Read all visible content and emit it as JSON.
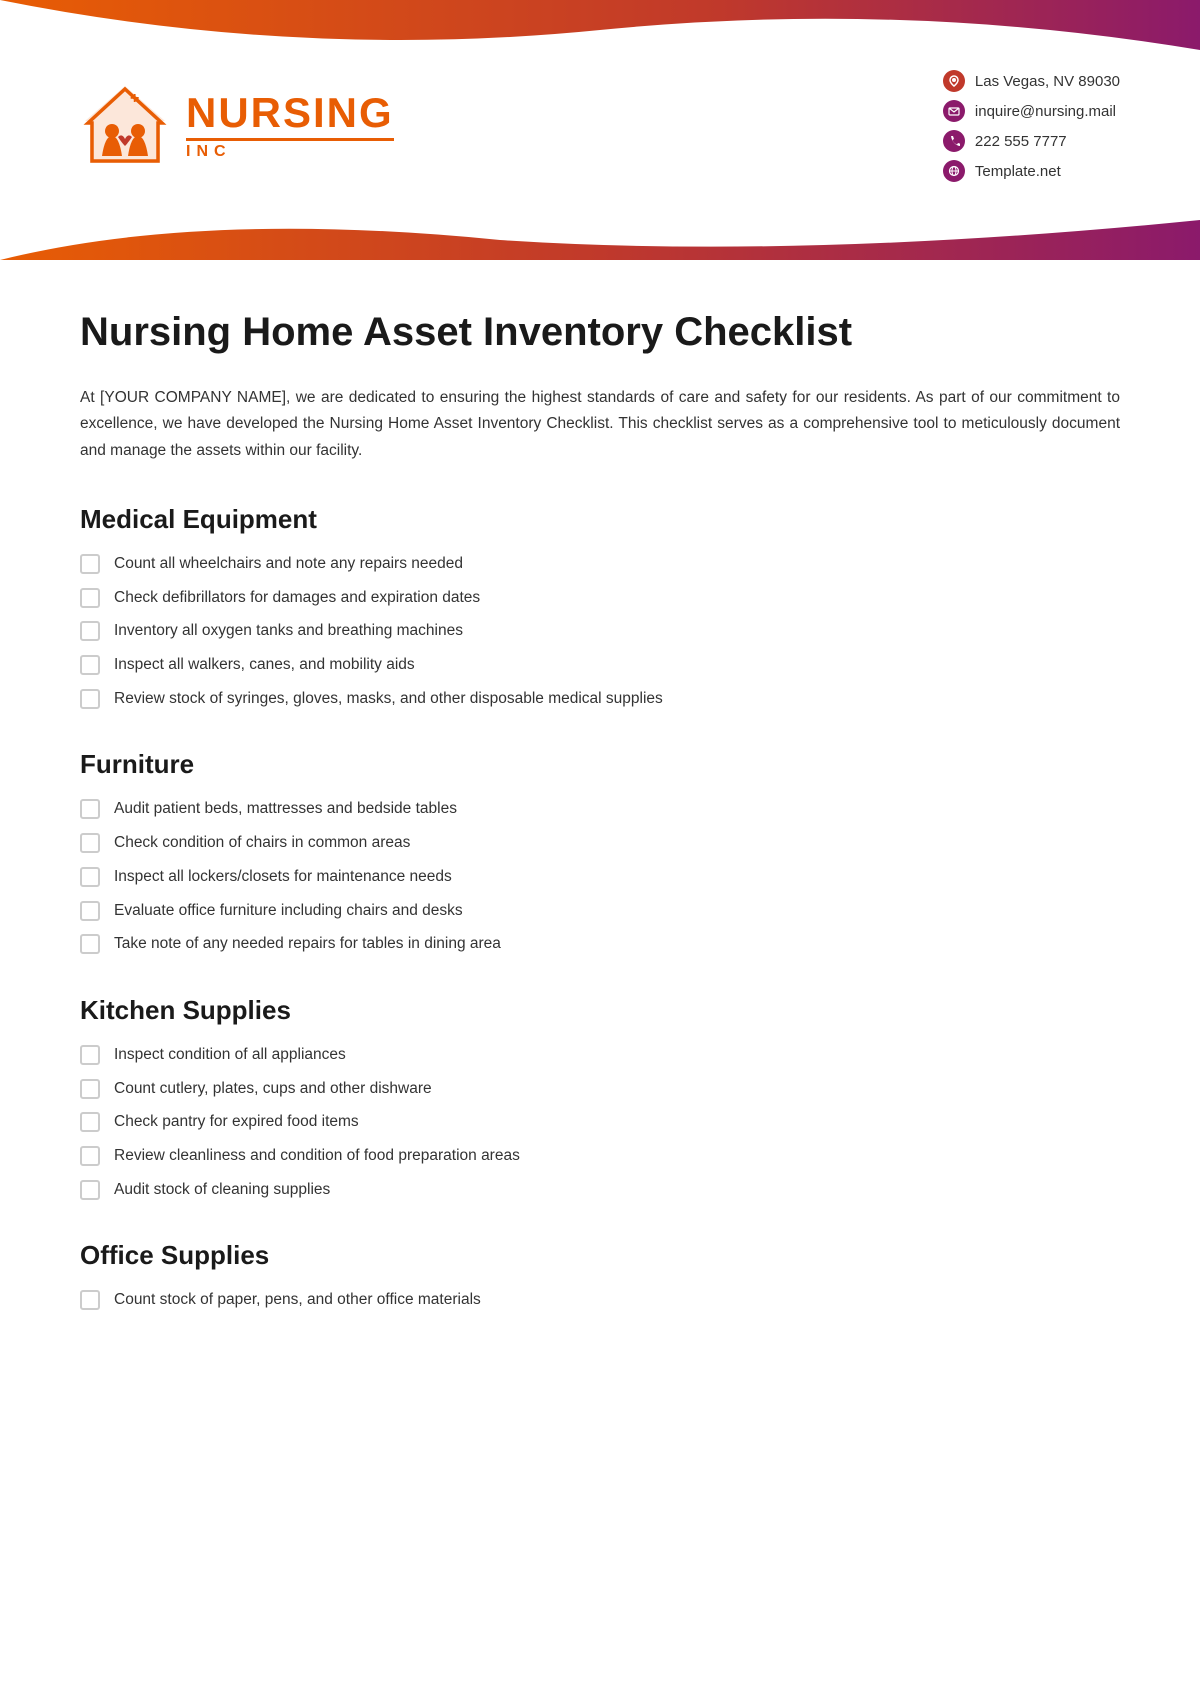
{
  "header": {
    "logo": {
      "name": "NURSING",
      "inc": "INC"
    },
    "contact": [
      {
        "type": "location",
        "icon": "📍",
        "text": "Las Vegas, NV 89030"
      },
      {
        "type": "email",
        "icon": "✉",
        "text": "inquire@nursing.mail"
      },
      {
        "type": "phone",
        "icon": "📞",
        "text": "222 555 7777"
      },
      {
        "type": "web",
        "icon": "🌐",
        "text": "Template.net"
      }
    ]
  },
  "page": {
    "title": "Nursing Home Asset Inventory Checklist",
    "intro": "At [YOUR COMPANY NAME], we are dedicated to ensuring the highest standards of care and safety for our residents. As part of our commitment to excellence, we have developed the Nursing Home Asset Inventory Checklist. This checklist serves as a comprehensive tool to meticulously document and manage the assets within our facility.",
    "sections": [
      {
        "title": "Medical Equipment",
        "items": [
          "Count all wheelchairs and note any repairs needed",
          "Check defibrillators for damages and expiration dates",
          "Inventory all oxygen tanks and breathing machines",
          "Inspect all walkers, canes, and mobility aids",
          "Review stock of syringes, gloves, masks, and other disposable medical supplies"
        ]
      },
      {
        "title": "Furniture",
        "items": [
          "Audit patient beds, mattresses and bedside tables",
          "Check condition of chairs in common areas",
          "Inspect all lockers/closets for maintenance needs",
          "Evaluate office furniture including chairs and desks",
          "Take note of any needed repairs for tables in dining area"
        ]
      },
      {
        "title": "Kitchen Supplies",
        "items": [
          "Inspect condition of all appliances",
          "Count cutlery, plates, cups and other dishware",
          "Check pantry for expired food items",
          "Review cleanliness and condition of food preparation areas",
          "Audit stock of cleaning supplies"
        ]
      },
      {
        "title": "Office Supplies",
        "items": [
          "Count stock of paper, pens, and other office materials"
        ]
      }
    ]
  }
}
